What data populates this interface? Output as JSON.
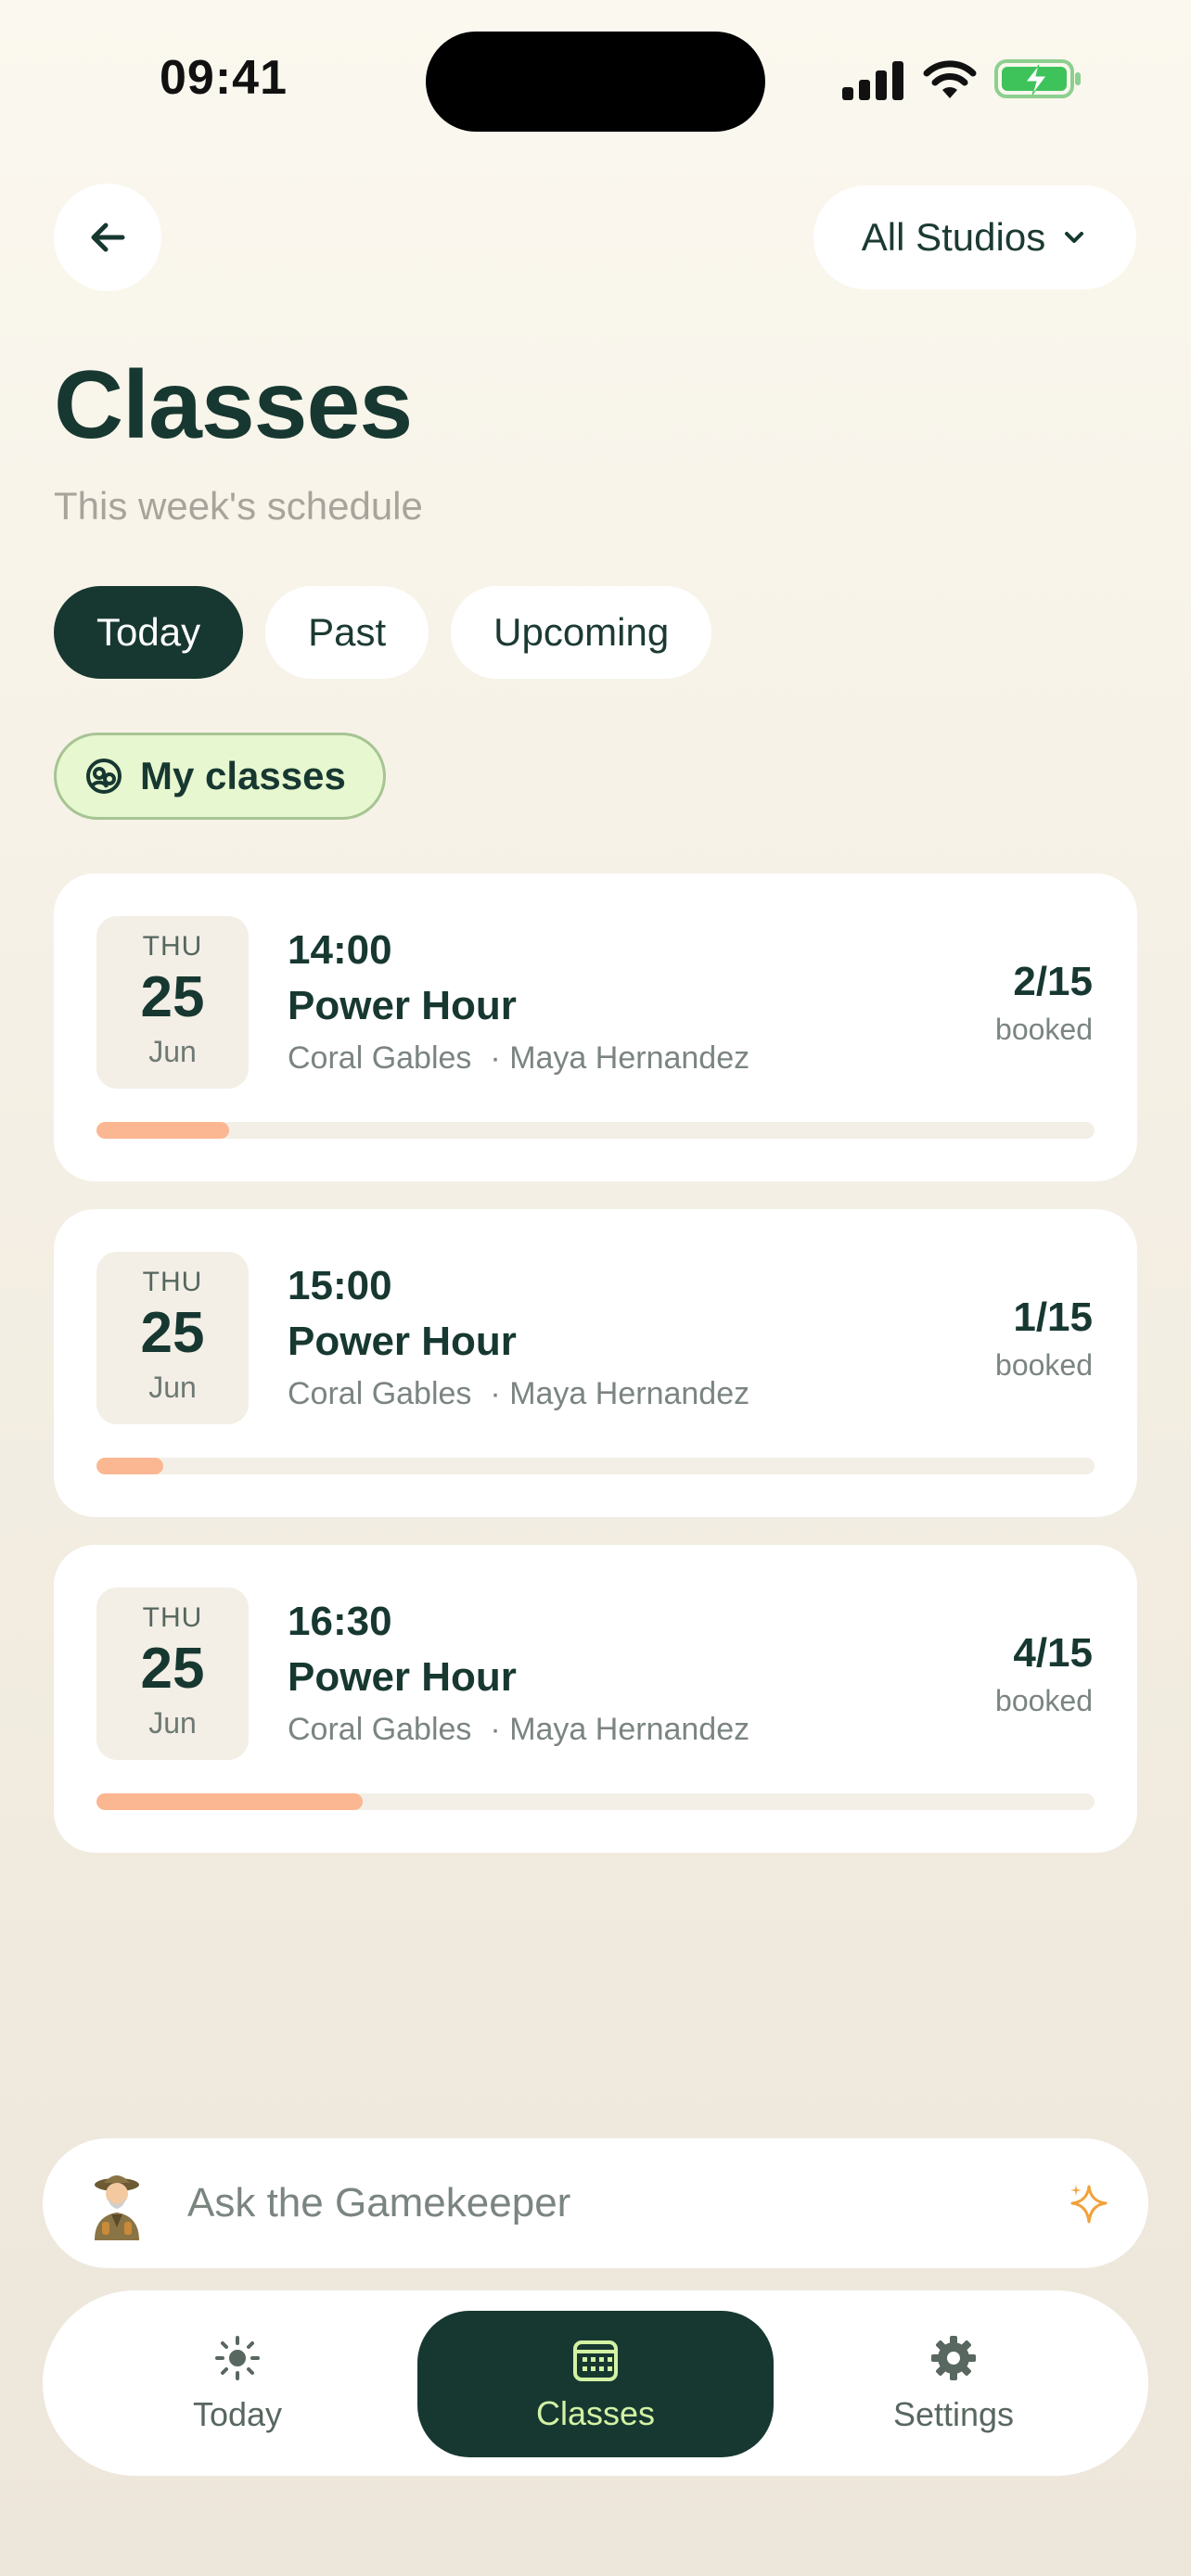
{
  "status_bar": {
    "time": "09:41"
  },
  "header": {
    "studio_filter": "All Studios"
  },
  "page": {
    "title": "Classes",
    "subtitle": "This week's schedule"
  },
  "tabs": [
    {
      "label": "Today",
      "active": true
    },
    {
      "label": "Past",
      "active": false
    },
    {
      "label": "Upcoming",
      "active": false
    }
  ],
  "filter_chip": {
    "label": "My classes"
  },
  "classes": [
    {
      "dow": "THU",
      "day": "25",
      "month": "Jun",
      "time": "14:00",
      "name": "Power Hour",
      "location": "Coral Gables",
      "instructor": "· Maya Hernandez",
      "booked": "2/15",
      "booked_label": "booked",
      "fill_fraction": 0.133
    },
    {
      "dow": "THU",
      "day": "25",
      "month": "Jun",
      "time": "15:00",
      "name": "Power Hour",
      "location": "Coral Gables",
      "instructor": "· Maya Hernandez",
      "booked": "1/15",
      "booked_label": "booked",
      "fill_fraction": 0.067
    },
    {
      "dow": "THU",
      "day": "25",
      "month": "Jun",
      "time": "16:30",
      "name": "Power Hour",
      "location": "Coral Gables",
      "instructor": "· Maya Hernandez",
      "booked": "4/15",
      "booked_label": "booked",
      "fill_fraction": 0.267
    }
  ],
  "ask_bar": {
    "placeholder": "Ask the Gamekeeper"
  },
  "nav": {
    "today": "Today",
    "classes": "Classes",
    "settings": "Settings"
  },
  "colors": {
    "primary": "#173831",
    "accent_lime": "#d3f2a4",
    "progress": "#fbb792",
    "chip_bg": "#e7f7cf",
    "sparkle": "#f0a23a"
  }
}
